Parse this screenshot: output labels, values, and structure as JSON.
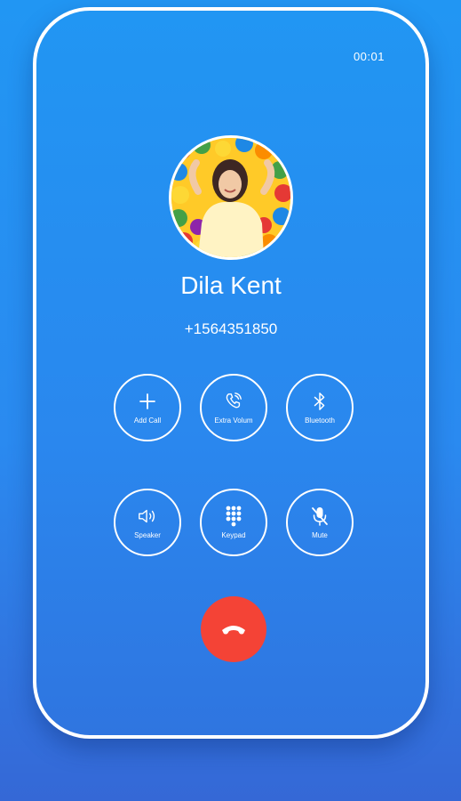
{
  "call": {
    "duration": "00:01",
    "contact_name": "Dila Kent",
    "phone_number": "+1564351850"
  },
  "actions": {
    "add_call": "Add Call",
    "extra_volume": "Extra Volum",
    "bluetooth": "Bluetooth",
    "speaker": "Speaker",
    "keypad": "Keypad",
    "mute": "Mute"
  },
  "icons": {
    "add_call": "plus-icon",
    "extra_volume": "phone-volume-icon",
    "bluetooth": "bluetooth-icon",
    "speaker": "speaker-icon",
    "keypad": "keypad-icon",
    "mute": "mic-off-icon",
    "end_call": "phone-hangup-icon"
  },
  "colors": {
    "background": "#2196F3",
    "end_call": "#F44336",
    "foreground": "#FFFFFF"
  }
}
